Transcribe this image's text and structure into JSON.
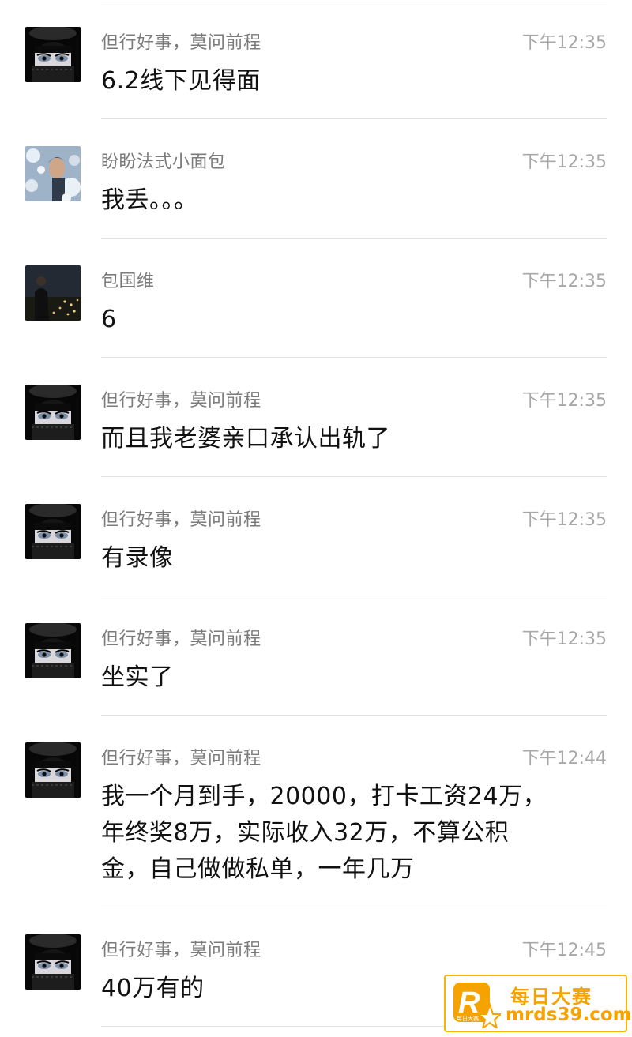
{
  "messages": [
    {
      "avatar": "dark-girl-avatar",
      "sender": "但行好事，莫问前程",
      "time": "下午12:35",
      "lines": [
        "6.2线下见得面"
      ]
    },
    {
      "avatar": "man-flowers-avatar",
      "sender": "盼盼法式小面包",
      "time": "下午12:35",
      "lines": [
        "我丢。。。"
      ]
    },
    {
      "avatar": "night-city-avatar",
      "sender": "包国维",
      "time": "下午12:35",
      "lines": [
        "6"
      ]
    },
    {
      "avatar": "dark-girl-avatar",
      "sender": "但行好事，莫问前程",
      "time": "下午12:35",
      "lines": [
        "而且我老婆亲口承认出轨了"
      ]
    },
    {
      "avatar": "dark-girl-avatar",
      "sender": "但行好事，莫问前程",
      "time": "下午12:35",
      "lines": [
        "有录像"
      ]
    },
    {
      "avatar": "dark-girl-avatar",
      "sender": "但行好事，莫问前程",
      "time": "下午12:35",
      "lines": [
        "坐实了"
      ]
    },
    {
      "avatar": "dark-girl-avatar",
      "sender": "但行好事，莫问前程",
      "time": "下午12:44",
      "lines": [
        "我一个月到手，20000，打卡工资24万，",
        "年终奖8万，实际收入32万，不算公积",
        "金，自己做做私单，一年几万"
      ]
    },
    {
      "avatar": "dark-girl-avatar",
      "sender": "但行好事，莫问前程",
      "time": "下午12:45",
      "lines": [
        "40万有的"
      ]
    }
  ],
  "watermark": {
    "logo_letter": "R",
    "logo_small": "每日大赛",
    "name": "每日大赛",
    "url": "mrds39.com",
    "color": "#f5a300"
  },
  "colors": {
    "sender": "#7b7b7b",
    "time": "#a8a8a8",
    "text": "#111111",
    "divider": "#e2e2e2"
  }
}
